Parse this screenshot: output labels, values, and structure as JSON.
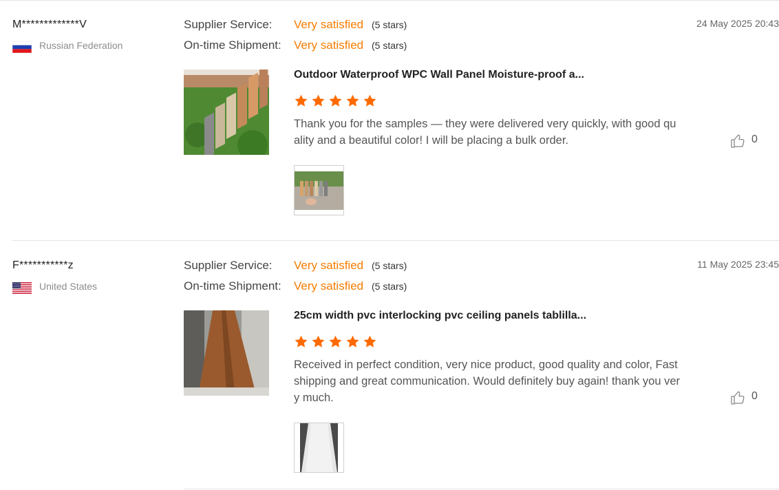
{
  "reviews": [
    {
      "buyer": "M*************V",
      "country": "Russian Federation",
      "flag": "russia-flag",
      "date": "24 May 2025 20:43",
      "ratings": [
        {
          "label": "Supplier Service:",
          "value": "Very satisfied",
          "stars": "(5 stars)"
        },
        {
          "label": "On-time Shipment:",
          "value": "Very satisfied",
          "stars": "(5 stars)"
        }
      ],
      "product_title": "Outdoor Waterproof WPC Wall Panel Moisture-proof a...",
      "star_count": 5,
      "text": "Thank you for the samples — they were delivered very quickly, with good quality and a beautiful color! I will be placing a bulk order.",
      "likes": "0"
    },
    {
      "buyer": "F***********z",
      "country": "United States",
      "flag": "usa-flag",
      "date": "11 May 2025 23:45",
      "ratings": [
        {
          "label": "Supplier Service:",
          "value": "Very satisfied",
          "stars": "(5 stars)"
        },
        {
          "label": "On-time Shipment:",
          "value": "Very satisfied",
          "stars": "(5 stars)"
        }
      ],
      "product_title": "25cm width pvc interlocking pvc ceiling panels tablilla...",
      "star_count": 5,
      "text": "Received in perfect condition, very nice product, good quality and color, Fast shipping and great communication. Would definitely buy again! thank you very much.",
      "likes": "0"
    }
  ],
  "colors": {
    "accent": "#f57c00",
    "star": "#ff6a00",
    "divider": "#e3e3e3"
  }
}
